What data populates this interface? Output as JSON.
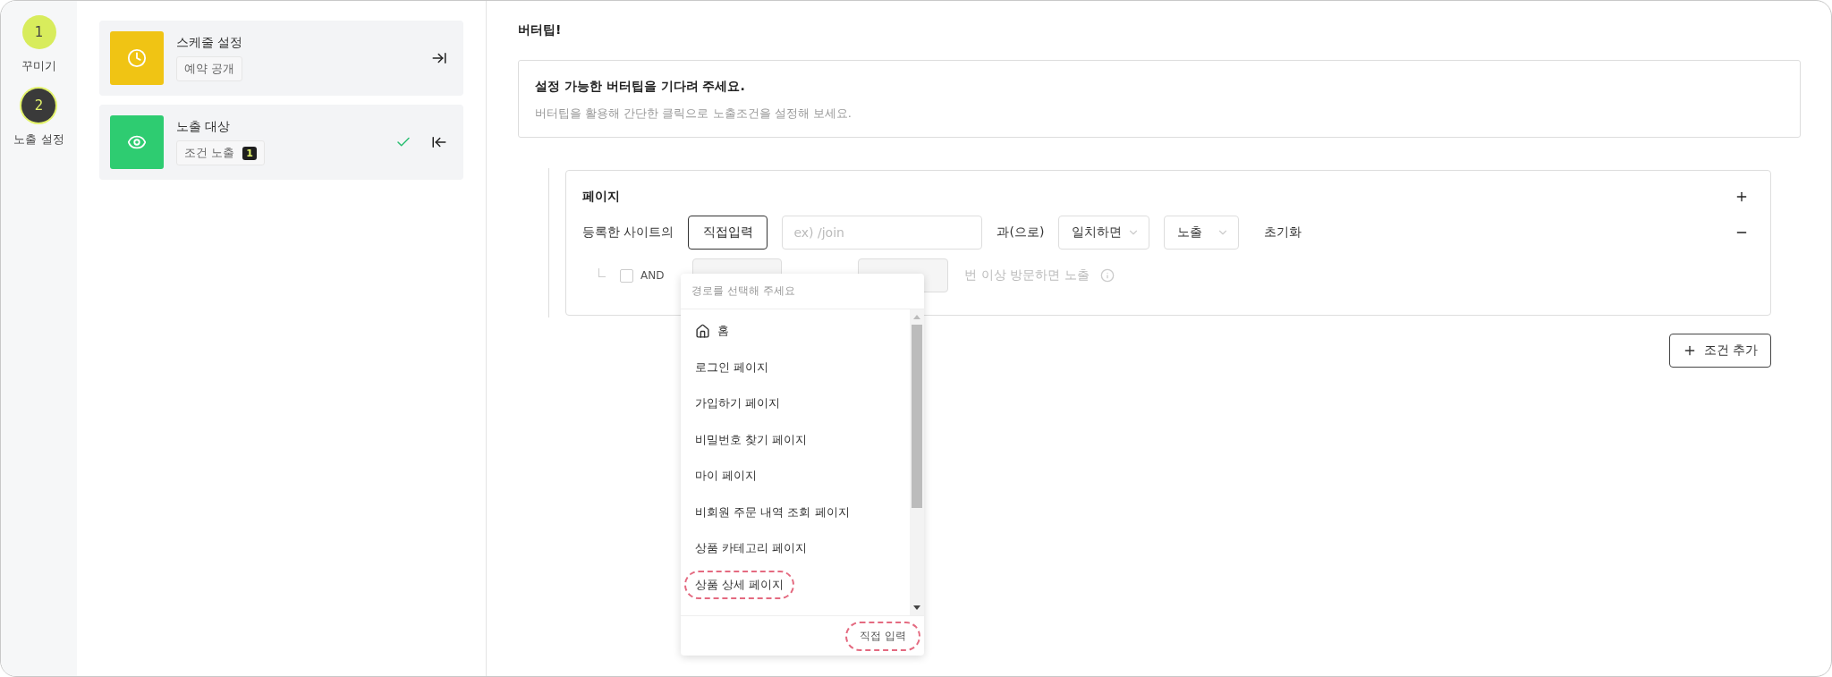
{
  "steps": [
    {
      "number": "1",
      "label": "꾸미기",
      "selected": false
    },
    {
      "number": "2",
      "label": "노출 설정",
      "selected": true
    }
  ],
  "cards": [
    {
      "kind": "schedule",
      "title": "스케줄 설정",
      "tag": "예약 공개",
      "done": false,
      "expanded": false
    },
    {
      "kind": "visibility",
      "title": "노출 대상",
      "tag": "조건 노출",
      "count": "1",
      "done": true,
      "expanded": true
    }
  ],
  "tip": {
    "heading": "버터팁!",
    "title": "설정 가능한 버터팁을 기다려 주세요.",
    "description": "버터팁을 활용해 간단한 클릭으로 노출조건을 설정해 보세요."
  },
  "condition": {
    "title": "페이지",
    "prefix": "등록한 사이트의",
    "mode_button": "직접입력",
    "path_placeholder": "ex) /join",
    "particle": "과(으로)",
    "match_select": "일치하면",
    "action_select": "노출",
    "reset": "초기화",
    "and_row": {
      "checked": false,
      "label": "AND",
      "suffix": "번 이상 방문하면 노출",
      "disabled": true
    }
  },
  "add_button": "조건 추가",
  "dropdown": {
    "header": "경로를 선택해 주세요",
    "items": [
      {
        "kind": "home",
        "label": "홈",
        "highlighted": false
      },
      {
        "kind": "page",
        "label": "로그인 페이지",
        "highlighted": false
      },
      {
        "kind": "page",
        "label": "가입하기 페이지",
        "highlighted": false
      },
      {
        "kind": "page",
        "label": "비밀번호 찾기 페이지",
        "highlighted": false
      },
      {
        "kind": "page",
        "label": "마이 페이지",
        "highlighted": false
      },
      {
        "kind": "page",
        "label": "비회원 주문 내역 조회 페이지",
        "highlighted": false
      },
      {
        "kind": "page",
        "label": "상품 카테고리 페이지",
        "highlighted": false
      },
      {
        "kind": "page",
        "label": "상품 상세 페이지",
        "highlighted": true
      }
    ],
    "footer": {
      "label": "직접 입력",
      "highlighted": true
    }
  }
}
